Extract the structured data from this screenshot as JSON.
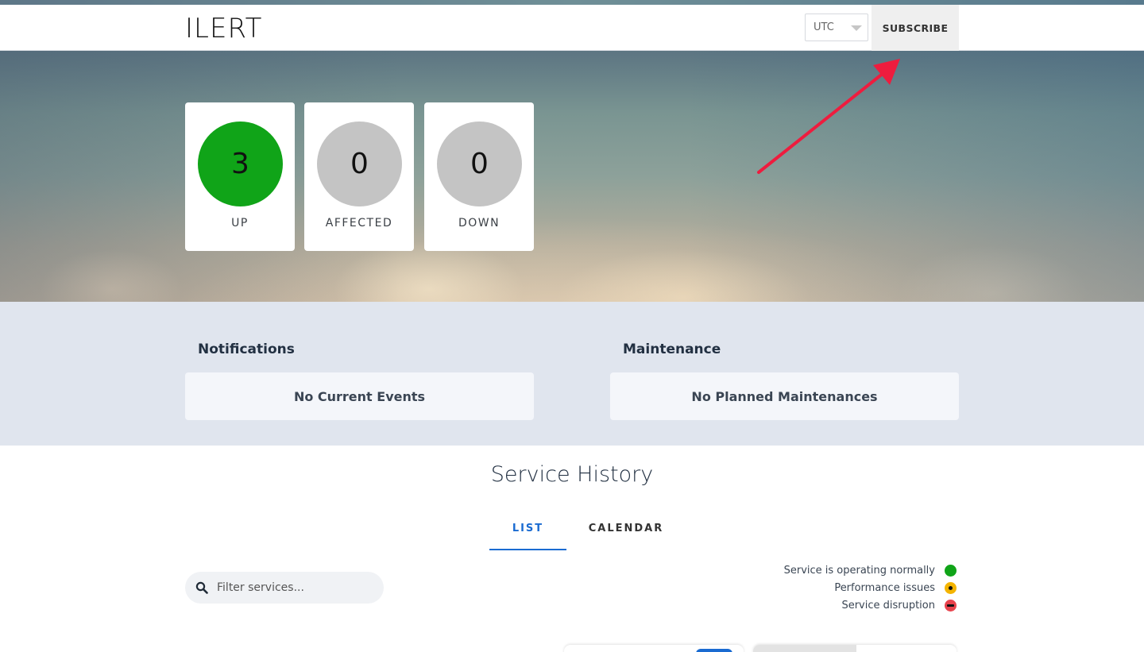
{
  "header": {
    "logo": "ILERT",
    "timezone": "UTC",
    "subscribe_label": "SUBSCRIBE"
  },
  "stats": [
    {
      "value": "3",
      "label": "UP",
      "color": "#10a418"
    },
    {
      "value": "0",
      "label": "AFFECTED",
      "color": "#c4c4c4"
    },
    {
      "value": "0",
      "label": "DOWN",
      "color": "#c4c4c4"
    }
  ],
  "annotation": {
    "arrow_color": "#ee1c3e"
  },
  "notifications": {
    "heading": "Notifications",
    "message": "No Current Events"
  },
  "maintenance": {
    "heading": "Maintenance",
    "message": "No Planned Maintenances"
  },
  "history": {
    "title": "Service History",
    "tabs": [
      {
        "label": "LIST",
        "active": true
      },
      {
        "label": "CALENDAR",
        "active": false
      }
    ],
    "filter_placeholder": "Filter services...",
    "legend": [
      {
        "label": "Service is operating normally",
        "icon": "status-green-dot-icon"
      },
      {
        "label": "Performance issues",
        "icon": "status-yellow-dot-icon"
      },
      {
        "label": "Service disruption",
        "icon": "status-red-dot-icon"
      }
    ]
  },
  "colors": {
    "accent": "#1a6bd1",
    "up": "#10a418",
    "neutral": "#c4c4c4",
    "warning": "#f4b400",
    "danger": "#e8434d"
  }
}
